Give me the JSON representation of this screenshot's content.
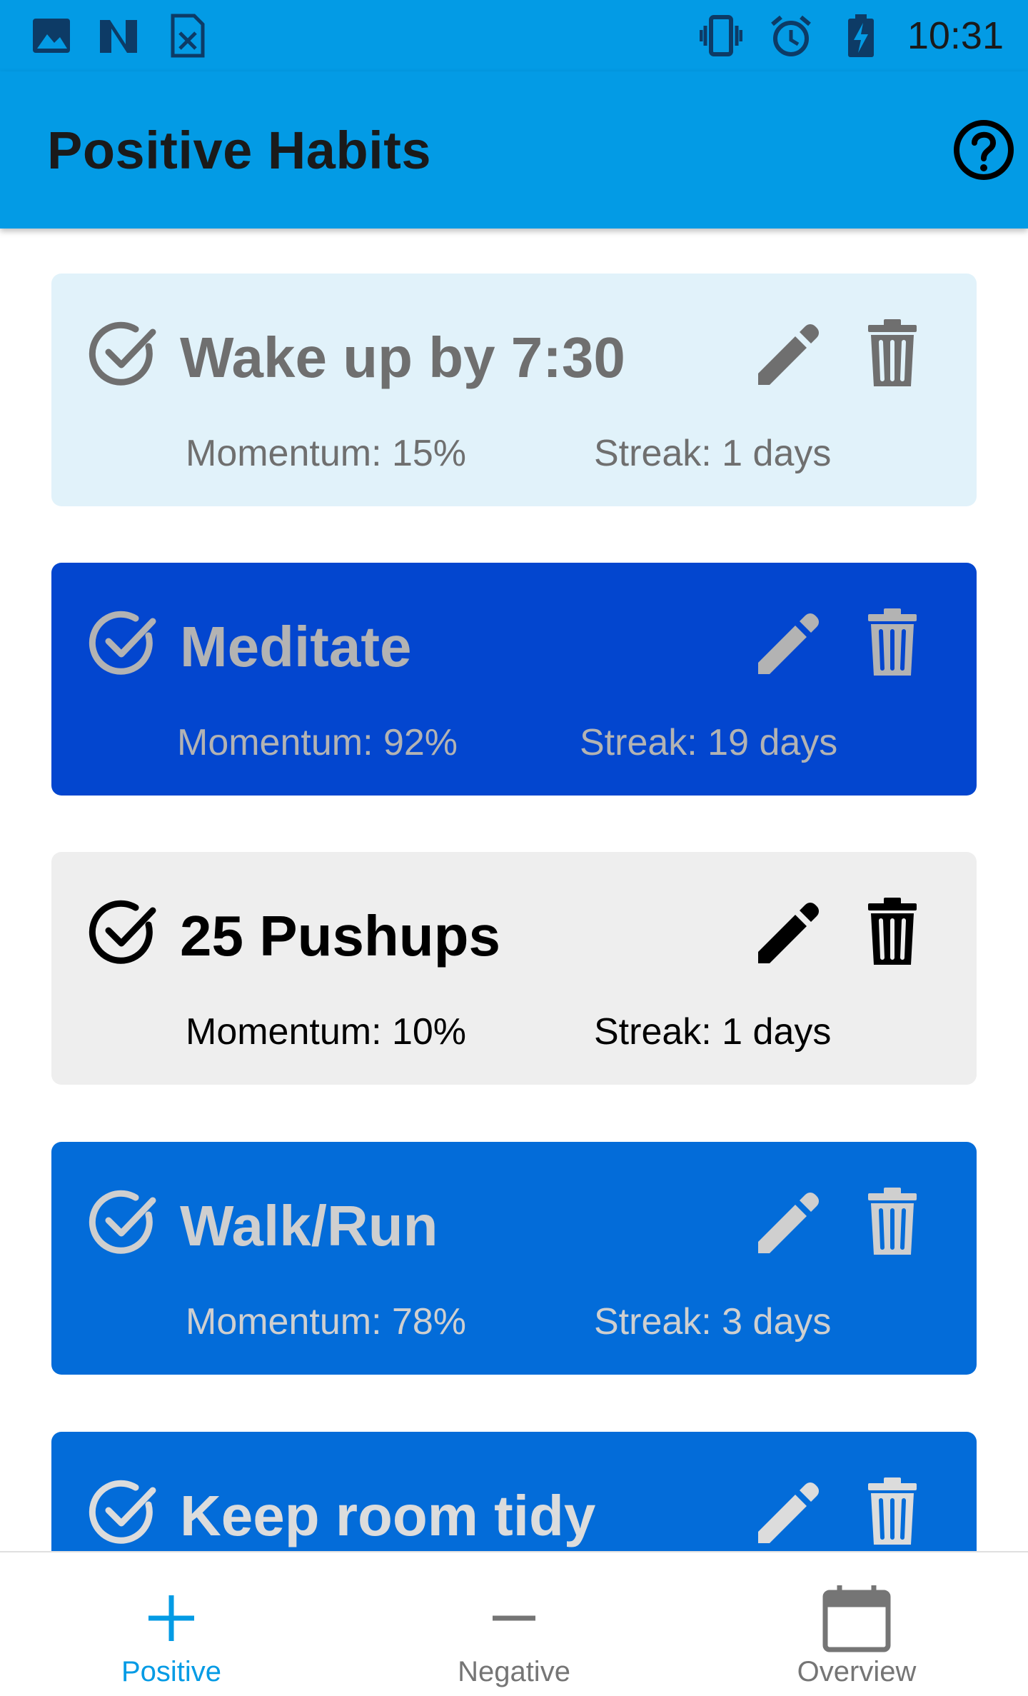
{
  "status_bar": {
    "time": "10:31",
    "left_icons": [
      "image-icon",
      "n-app-icon",
      "spreadsheet-icon"
    ],
    "right_icons": [
      "vibrate-icon",
      "alarm-icon",
      "battery-charging-icon"
    ]
  },
  "app_bar": {
    "title": "Positive Habits",
    "help_icon": "help-circle-icon",
    "background": "#039be5"
  },
  "habits": [
    {
      "name": "Wake up by 7:30",
      "momentum": "Momentum: 15%",
      "streak": "Streak: 1 days",
      "background": "#e1f2fa",
      "text_color": "#6f6f6f"
    },
    {
      "name": "Meditate",
      "momentum": "Momentum: 92%",
      "streak": "Streak: 19 days",
      "background": "#0346cf",
      "text_color": "#b3b3b3"
    },
    {
      "name": "25 Pushups",
      "momentum": "Momentum: 10%",
      "streak": "Streak: 1 days",
      "background": "#eeeeee",
      "text_color": "#000000"
    },
    {
      "name": "Walk/Run",
      "momentum": "Momentum: 78%",
      "streak": "Streak: 3 days",
      "background": "#036cd9",
      "text_color": "#cfcfcf"
    },
    {
      "name": "Keep room tidy",
      "momentum": "",
      "streak": "",
      "background": "#036cd9",
      "text_color": "#dcdcdc"
    }
  ],
  "bottom_nav": {
    "items": [
      {
        "label": "Positive",
        "icon": "plus-icon",
        "active": true
      },
      {
        "label": "Negative",
        "icon": "minus-icon",
        "active": false
      },
      {
        "label": "Overview",
        "icon": "calendar-icon",
        "active": false
      }
    ],
    "active_color": "#039be5",
    "inactive_color": "#757575"
  }
}
